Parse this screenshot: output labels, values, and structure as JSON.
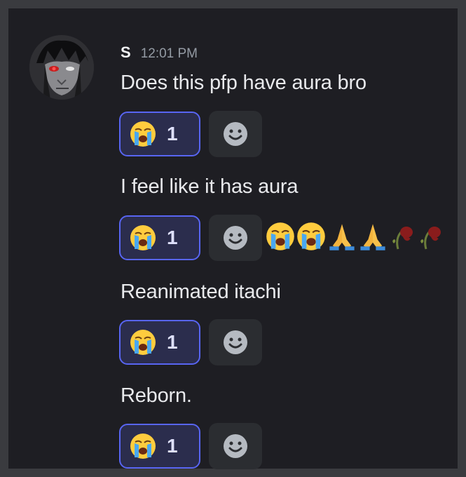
{
  "message": {
    "author": "S",
    "timestamp": "12:01 PM"
  },
  "messages": [
    {
      "text": "Does this pfp have aura bro",
      "reaction": {
        "emoji": "loudly-crying-face",
        "count": "1"
      }
    },
    {
      "text": "I feel like it has aura",
      "reaction": {
        "emoji": "loudly-crying-face",
        "count": "1"
      },
      "trailing_emojis": [
        "loudly-crying-face",
        "loudly-crying-face",
        "folded-hands",
        "folded-hands",
        "wilted-flower",
        "wilted-flower"
      ]
    },
    {
      "text": "Reanimated itachi",
      "reaction": {
        "emoji": "loudly-crying-face",
        "count": "1"
      }
    },
    {
      "text": "Reborn.",
      "reaction": {
        "emoji": "loudly-crying-face",
        "count": "1"
      }
    }
  ],
  "colors": {
    "background": "#1e1e23",
    "reaction_border": "#5865f2",
    "reaction_bg": "#2b2d4d",
    "text": "#e8e9ec"
  }
}
